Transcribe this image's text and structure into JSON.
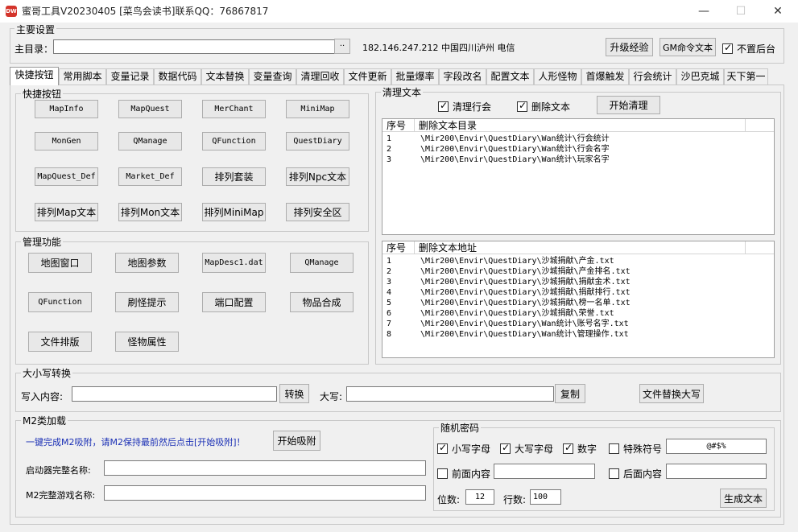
{
  "window": {
    "title": "蜜哥工具V20230405 [菜鸟会读书]联系QQ：76867817",
    "icon_text": "DW"
  },
  "main_settings": {
    "group_title": "主要设置",
    "dir_label": "主目录：",
    "dir_value": "",
    "browse_label": "··",
    "ip_info": "182.146.247.212  中国四川泸州 电信",
    "upgrade_label": "升级经验",
    "gm_label": "GM命令文本",
    "not_top_label": "不置后台",
    "not_top_checked": true
  },
  "tabs": [
    "快捷按钮",
    "常用脚本",
    "变量记录",
    "数据代码",
    "文本替换",
    "变量查询",
    "清理回收",
    "文件更新",
    "批量爆率",
    "字段改名",
    "配置文本",
    "人形怪物",
    "首爆触发",
    "行会统计",
    "沙巴克城",
    "天下第一"
  ],
  "quick": {
    "group_title": "快捷按钮",
    "buttons": [
      "MapInfo",
      "MapQuest",
      "MerChant",
      "MiniMap",
      "MonGen",
      "QManage",
      "QFunction",
      "QuestDiary",
      "MapQuest_Def",
      "Market_Def",
      "排列套装",
      "排列Npc文本",
      "排列Map文本",
      "排列Mon文本",
      "排列MiniMap",
      "排列安全区"
    ]
  },
  "manage": {
    "group_title": "管理功能",
    "buttons": [
      "地图窗口",
      "地图参数",
      "MapDesc1.dat",
      "QManage",
      "QFunction",
      "刷怪提示",
      "端口配置",
      "物品合成",
      "文件排版",
      "怪物属性"
    ]
  },
  "clean": {
    "group_title": "清理文本",
    "clean_guild_label": "清理行会",
    "clean_guild_checked": true,
    "delete_text_label": "删除文本",
    "delete_text_checked": true,
    "start_label": "开始清理",
    "list1": {
      "col_no": "序号",
      "col_path": "删除文本目录",
      "rows": [
        {
          "no": "1",
          "path": "\\Mir200\\Envir\\QuestDiary\\Wan统计\\行会统计"
        },
        {
          "no": "2",
          "path": "\\Mir200\\Envir\\QuestDiary\\Wan统计\\行会名字"
        },
        {
          "no": "3",
          "path": "\\Mir200\\Envir\\QuestDiary\\Wan统计\\玩家名字"
        }
      ]
    },
    "list2": {
      "col_no": "序号",
      "col_path": "删除文本地址",
      "rows": [
        {
          "no": "1",
          "path": "\\Mir200\\Envir\\QuestDiary\\沙城捐献\\产金.txt"
        },
        {
          "no": "2",
          "path": "\\Mir200\\Envir\\QuestDiary\\沙城捐献\\产金排名.txt"
        },
        {
          "no": "3",
          "path": "\\Mir200\\Envir\\QuestDiary\\沙城捐献\\捐献金术.txt"
        },
        {
          "no": "4",
          "path": "\\Mir200\\Envir\\QuestDiary\\沙城捐献\\捐献排行.txt"
        },
        {
          "no": "5",
          "path": "\\Mir200\\Envir\\QuestDiary\\沙城捐献\\榜一名单.txt"
        },
        {
          "no": "6",
          "path": "\\Mir200\\Envir\\QuestDiary\\沙城捐献\\荣誉.txt"
        },
        {
          "no": "7",
          "path": "\\Mir200\\Envir\\QuestDiary\\Wan统计\\账号名字.txt"
        },
        {
          "no": "8",
          "path": "\\Mir200\\Envir\\QuestDiary\\Wan统计\\管理操作.txt"
        }
      ]
    }
  },
  "case_convert": {
    "group_title": "大小写转换",
    "input_label": "写入内容:",
    "input_value": "",
    "convert_label": "转换",
    "upper_label": "大写:",
    "upper_value": "",
    "copy_label": "复制",
    "replace_label": "文件替换大写"
  },
  "m2": {
    "group_title": "M2类加载",
    "hint": "一键完成M2吸附，请M2保持最前然后点击[开始吸附]！",
    "start_label": "开始吸附",
    "launcher_label": "启动器完整名称:",
    "launcher_value": "",
    "game_label": "M2完整游戏名称:",
    "game_value": ""
  },
  "password": {
    "group_title": "随机密码",
    "lower_label": "小写字母",
    "lower_checked": true,
    "upper_label": "大写字母",
    "upper_checked": true,
    "digit_label": "数字",
    "digit_checked": true,
    "special_label": "特殊符号",
    "special_checked": false,
    "special_value": "@#$%",
    "prefix_label": "前面内容",
    "prefix_checked": false,
    "prefix_value": "",
    "suffix_label": "后面内容",
    "suffix_checked": false,
    "suffix_value": "",
    "digits_label": "位数:",
    "digits_value": "12",
    "lines_label": "行数:",
    "lines_value": "100",
    "generate_label": "生成文本"
  }
}
